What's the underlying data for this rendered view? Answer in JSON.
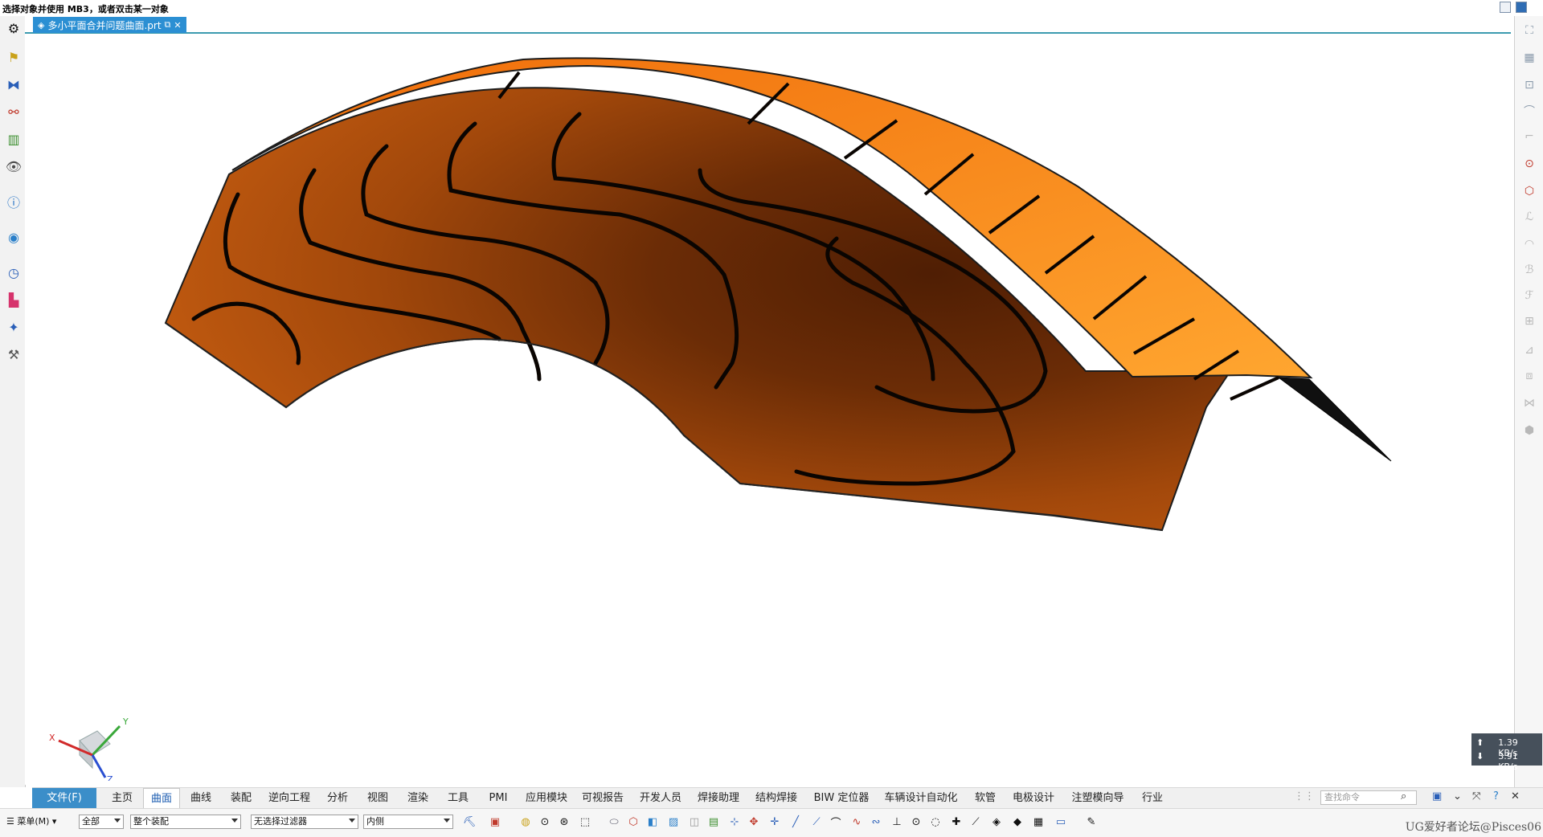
{
  "status": {
    "prompt": "选择对象并使用 MB3，或者双击某一对象"
  },
  "tab": {
    "title": "多小平面合并问题曲面.prt"
  },
  "left_toolbar": {
    "icons": [
      "settings-icon",
      "part-navigator-icon",
      "assembly-navigator-icon",
      "constraint-navigator-icon",
      "reuse-library-icon",
      "visibility-icon",
      "info-icon",
      "web-browser-icon",
      "history-icon",
      "palette-icon",
      "role-icon",
      "tools-icon"
    ]
  },
  "right_toolbar": {
    "icons": [
      "view-orient-icon",
      "shaded-icon",
      "snap-icon",
      "curve-icon",
      "curve-trim-icon",
      "point-icon",
      "hex-icon",
      "sweep-icon",
      "surface-icon",
      "mesh-icon",
      "modify-icon",
      "add-icon",
      "trim-icon",
      "section-icon",
      "grid-icon",
      "box-icon"
    ]
  },
  "net_speed": {
    "up": "1.39 KB/s",
    "down": "3.91 KB/s"
  },
  "ribbon": {
    "file": "文件(F)",
    "tabs": [
      "主页",
      "曲面",
      "曲线",
      "装配",
      "逆向工程",
      "分析",
      "视图",
      "渲染",
      "工具",
      "PMI",
      "应用模块",
      "可视报告",
      "开发人员",
      "焊接助理",
      "结构焊接",
      "BIW 定位器",
      "车辆设计自动化",
      "软管",
      "电极设计",
      "注塑模向导",
      "行业"
    ],
    "active_tab": "曲面",
    "search_placeholder": "查找命令"
  },
  "selection_bar": {
    "menu_label": "菜单(M)",
    "filter_all": "全部",
    "scope": "整个装配",
    "type_filter": "无选择过滤器",
    "inside": "内侧"
  },
  "axes": {
    "x": "X",
    "y": "Y",
    "z": "Z"
  },
  "watermark": "UG爱好者论坛@Pisces06",
  "colors": {
    "accent": "#2b8fd3",
    "surface_dark": "#5a2405",
    "surface_mid": "#b5520b",
    "surface_light": "#ff9a1c",
    "contour": "#0a0502"
  }
}
